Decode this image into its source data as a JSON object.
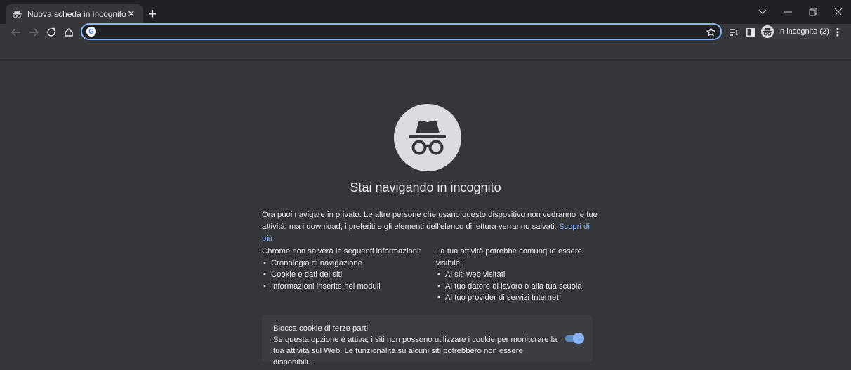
{
  "tab": {
    "title": "Nuova scheda in incognito",
    "close_glyph": "✕",
    "icon": "incognito-icon"
  },
  "newtab_glyph": "+",
  "window_controls": {
    "tab_search_glyph": "⌄",
    "minimize_glyph": "—",
    "restore_glyph": "❐",
    "close_glyph": "✕"
  },
  "toolbar": {
    "omnibox_value": "",
    "profile_label": "In incognito (2)",
    "menu_glyph": "⋮"
  },
  "content": {
    "headline": "Stai navigando in incognito",
    "intro_text": "Ora puoi navigare in privato. Le altre persone che usano questo dispositivo non vedranno le tue attività, ma i download, i preferiti e gli elementi dell'elenco di lettura verranno salvati.",
    "learn_more": "Scopri di più",
    "left_column": {
      "heading": "Chrome non salverà le seguenti informazioni:",
      "items": [
        "Cronologia di navigazione",
        "Cookie e dati dei siti",
        "Informazioni inserite nei moduli"
      ]
    },
    "right_column": {
      "heading": "La tua attività potrebbe comunque essere visibile:",
      "items": [
        "Ai siti web visitati",
        "Al tuo datore di lavoro o alla tua scuola",
        "Al tuo provider di servizi Internet"
      ]
    },
    "cookie_card": {
      "title": "Blocca cookie di terze parti",
      "description": "Se questa opzione è attiva, i siti non possono utilizzare i cookie per monitorare la tua attività sul Web. Le funzionalità su alcuni siti potrebbero non essere disponibili.",
      "toggle_on": true
    }
  },
  "colors": {
    "background": "#35363a",
    "tabstrip": "#202124",
    "accent": "#8ab4f8",
    "card": "#3c3d41"
  }
}
